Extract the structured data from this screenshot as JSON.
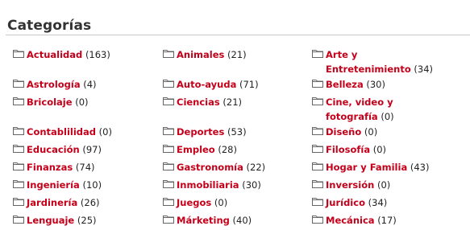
{
  "header": {
    "title": "Categorías"
  },
  "colors": {
    "link": "#c4001a",
    "rule": "#c8c8c8",
    "icon": "#666666"
  },
  "icon_name": "folder-icon",
  "categories": [
    {
      "name": "Actualidad",
      "count": "(163)"
    },
    {
      "name": "Animales",
      "count": "(21)"
    },
    {
      "name_line1": "Arte y",
      "name_line2": "Entretenimiento",
      "count": "(34)"
    },
    {
      "name": "Astrología",
      "count": "(4)"
    },
    {
      "name": "Auto-ayuda",
      "count": "(71)"
    },
    {
      "name": "Belleza",
      "count": "(30)"
    },
    {
      "name": "Bricolaje",
      "count": "(0)"
    },
    {
      "name": "Ciencias",
      "count": "(21)"
    },
    {
      "name_line1": "Cine, video y",
      "name_line2": "fotografía",
      "count": "(0)"
    },
    {
      "name": "Contablilidad",
      "count": "(0)"
    },
    {
      "name": "Deportes",
      "count": "(53)"
    },
    {
      "name": "Diseño",
      "count": "(0)"
    },
    {
      "name": "Educación",
      "count": "(97)"
    },
    {
      "name": "Empleo",
      "count": "(28)"
    },
    {
      "name": "Filosofía",
      "count": "(0)"
    },
    {
      "name": "Finanzas",
      "count": "(74)"
    },
    {
      "name": "Gastronomía",
      "count": "(22)"
    },
    {
      "name": "Hogar y Familia",
      "count": "(43)"
    },
    {
      "name": "Ingeniería",
      "count": "(10)"
    },
    {
      "name": "Inmobiliaria",
      "count": "(30)"
    },
    {
      "name": "Inversión",
      "count": "(0)"
    },
    {
      "name": "Jardinería",
      "count": "(26)"
    },
    {
      "name": "Juegos",
      "count": "(0)"
    },
    {
      "name": "Jurídico",
      "count": "(34)"
    },
    {
      "name": "Lenguaje",
      "count": "(25)"
    },
    {
      "name": "Márketing",
      "count": "(40)"
    },
    {
      "name": "Mecánica",
      "count": "(17)"
    }
  ]
}
